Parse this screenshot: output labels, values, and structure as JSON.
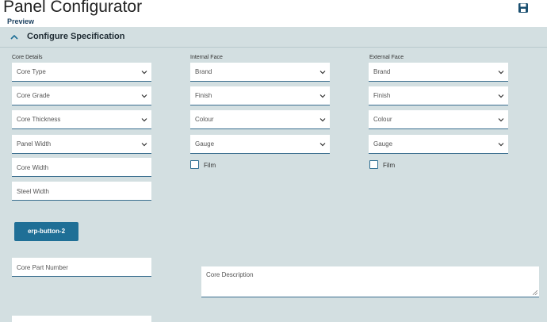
{
  "app": {
    "title": "Panel Configurator",
    "preview_label": "Preview",
    "save_icon": "save-icon"
  },
  "section": {
    "title": "Configure Specification",
    "toggle_icon": "chevron-up-icon"
  },
  "core_details": {
    "label": "Core Details",
    "selects": [
      "Core Type",
      "Core Grade",
      "Core Thickness",
      "Panel Width"
    ],
    "fields": [
      "Core Width",
      "Steel Width"
    ]
  },
  "internal_face": {
    "label": "Internal Face",
    "selects": [
      "Brand",
      "Finish",
      "Colour",
      "Gauge"
    ],
    "checkbox_label": "Film"
  },
  "external_face": {
    "label": "External Face",
    "selects": [
      "Brand",
      "Finish",
      "Colour",
      "Gauge"
    ],
    "checkbox_label": "Film"
  },
  "button": {
    "label": "erp-button-2"
  },
  "core_part_number": {
    "placeholder": "Core Part Number"
  },
  "core_description": {
    "placeholder": "Core Description"
  },
  "colors": {
    "background": "#d3dfe1",
    "accent": "#1f6f96",
    "field_border": "#3b6f8f"
  }
}
